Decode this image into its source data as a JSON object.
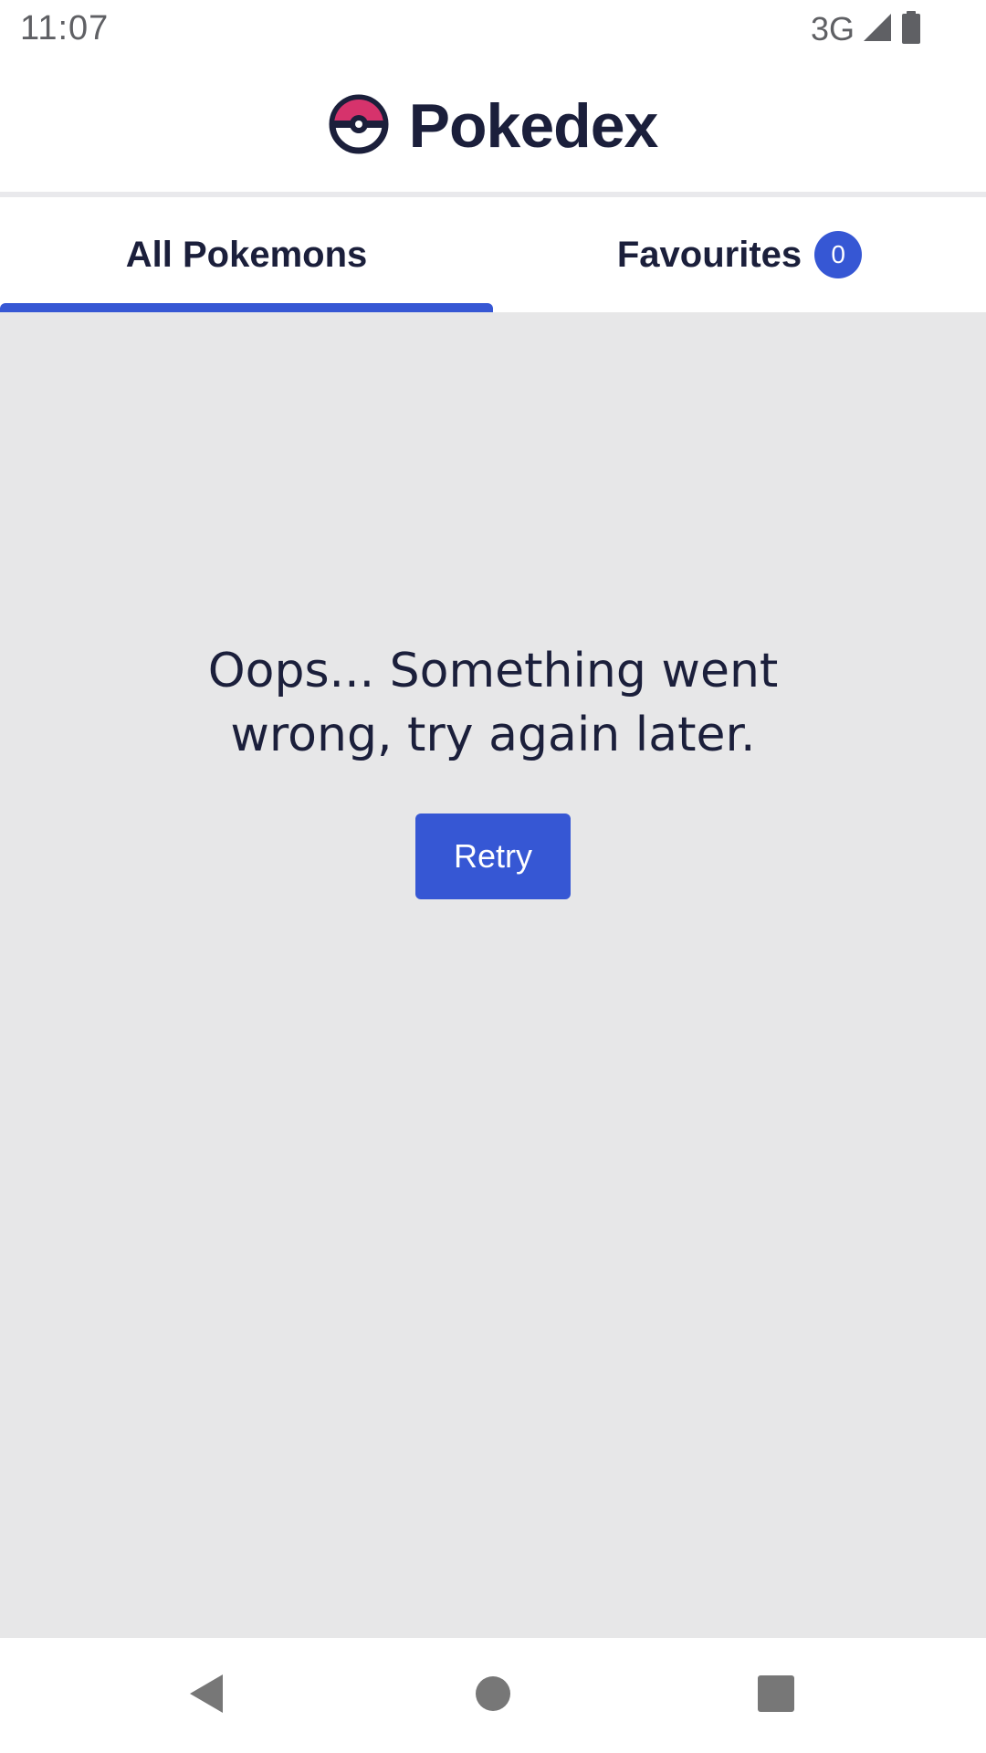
{
  "status_bar": {
    "time": "11:07",
    "network": "3G",
    "icons": [
      "signal-icon",
      "battery-icon"
    ]
  },
  "header": {
    "title": "Pokedex",
    "logo_icon": "pokeball-icon",
    "colors": {
      "title": "#1b1f3b",
      "logo_top": "#d6336c",
      "logo_outline": "#1b1f3b"
    }
  },
  "tabs": [
    {
      "label": "All Pokemons",
      "active": true
    },
    {
      "label": "Favourites",
      "active": false,
      "badge": "0"
    }
  ],
  "main": {
    "error_message": "Oops... Something went wrong, try again later.",
    "retry_label": "Retry"
  },
  "nav_bar": {
    "icons": [
      "back-icon",
      "home-icon",
      "recents-icon"
    ]
  },
  "colors": {
    "accent": "#3657d4",
    "content_background": "#e7e7e8",
    "text": "#1b1f3b"
  }
}
